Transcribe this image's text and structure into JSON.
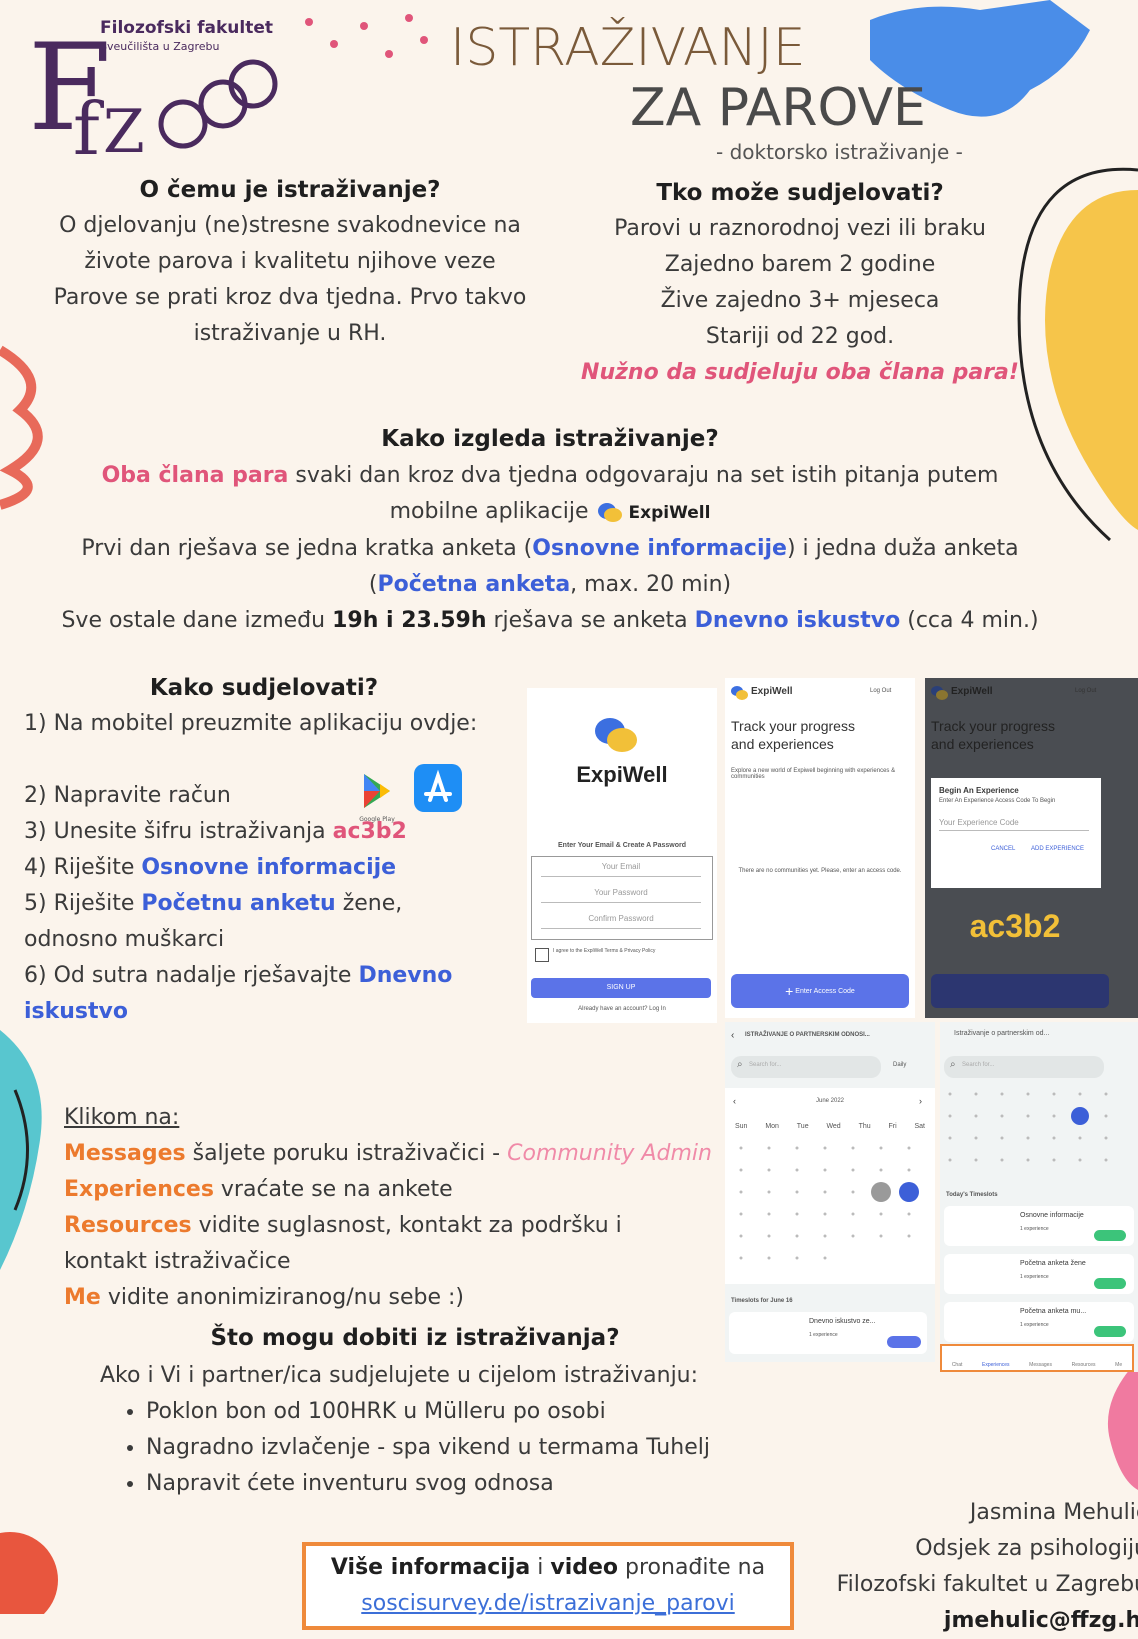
{
  "logo": {
    "faculty_name": "Filozofski fakultet",
    "faculty_sub": "Sveučilišta u Zagrebu",
    "monogram": "FfZG"
  },
  "title": {
    "line1": "ISTRAŽIVANJE",
    "line2": "ZA PAROVE",
    "subtitle": "- doktorsko istraživanje -"
  },
  "about": {
    "heading": "O čemu je istraživanje?",
    "line1": "O djelovanju (ne)stresne svakodnevice na",
    "line2": "živote parova i kvalitetu njihove veze",
    "line3": "Parove se prati kroz dva tjedna. Prvo takvo",
    "line4": "istraživanje u RH."
  },
  "who": {
    "heading": "Tko  može sudjelovati?",
    "line1": "Parovi u raznorodnoj vezi ili braku",
    "line2": "Zajedno barem 2 godine",
    "line3": "Žive zajedno 3+ mjeseca",
    "line4": "Stariji od 22 god.",
    "emphasis": "Nužno da sudjeluju oba člana para!"
  },
  "how": {
    "heading": "Kako izgleda istraživanje?",
    "p1_pink": "Oba člana para",
    "p1_rest": " svaki dan kroz dva tjedna odgovaraju na set istih pitanja putem",
    "p2": "mobilne aplikacije",
    "app_name": "ExpiWell",
    "p3_a": "Prvi dan rješava se jedna kratka anketa (",
    "p3_blue1": "Osnovne informacije",
    "p3_b": ") i jedna duža anketa",
    "p4_a": "(",
    "p4_blue": "Početna anketa",
    "p4_b": ", max. 20 min)",
    "p5_a": "Sve ostale dane između ",
    "p5_bold": "19h i 23.59h",
    "p5_b": " rješava se anketa ",
    "p5_blue": "Dnevno iskustvo",
    "p5_c": " (cca 4 min.)"
  },
  "steps": {
    "heading": "Kako sudjelovati?",
    "s1": "1) Na mobitel preuzmite aplikaciju ovdje:",
    "s2": "2) Napravite račun",
    "s3_a": "3) Unesite šifru istraživanja ",
    "s3_code": "ac3b2",
    "s4_a": "4) Riješite ",
    "s4_blue": "Osnovne informacije",
    "s5_a": "5) Riješite ",
    "s5_blue": "Početnu anketu",
    "s5_b": " žene,",
    "s5_c": "odnosno muškarci",
    "s6_a": "6) Od sutra nadalje rješavajte ",
    "s6_blue1": "Dnevno",
    "s6_blue2": "iskustvo",
    "google_play_label": "Google Play"
  },
  "click": {
    "heading": "Klikom na:",
    "messages": "Messages",
    "messages_rest": " šaljete poruku istraživačici - ",
    "community_admin": "Community Admin",
    "experiences": "Experiences",
    "experiences_rest": " vraćate se na ankete",
    "resources": "Resources",
    "resources_rest": " vidite suglasnost, kontakt za podršku i",
    "resources_rest2": "kontakt istraživačice",
    "me": "Me",
    "me_rest": " vidite anonimiziranog/nu sebe :)"
  },
  "gain": {
    "heading": "Što mogu dobiti iz istraživanja?",
    "intro": "Ako i Vi i partner/ica sudjelujete u cijelom istraživanju:",
    "items": [
      "Poklon bon od 100HRK u Mülleru po osobi",
      "Nagradno izvlačenje - spa vikend u termama Tuhelj",
      "Napravit ćete inventuru svog odnosa"
    ]
  },
  "more": {
    "bold1": "Više informacija",
    "mid": " i ",
    "bold2": "video",
    "rest": " pronađite na",
    "link": "soscisurvey.de/istrazivanje_parovi"
  },
  "contact": {
    "name": "Jasmina Mehulić",
    "dept": "Odsjek za psihologiju",
    "faculty": "Filozofski fakultet u Zagrebu",
    "email": "jmehulic@ffzg.hr"
  },
  "phones": {
    "p1": {
      "brand": "ExpiWell",
      "form_title": "Enter Your Email & Create A Password",
      "email": "Your Email",
      "password": "Your Password",
      "confirm": "Confirm Password",
      "agree": "I agree to the ExpiWell Terms & Privacy Policy",
      "signup": "SIGN UP",
      "login": "Already have an account? Log In"
    },
    "p2": {
      "brand": "ExpiWell",
      "logout": "Log Out",
      "track1": "Track your progress",
      "track2": "and experiences",
      "explore": "Explore a new world of Expiwell beginning with experiences & communities",
      "empty": "There are no communities yet. Please, enter an access code.",
      "enter_code": "Enter Access Code"
    },
    "p3": {
      "brand": "ExpiWell",
      "logout": "Log Out",
      "track1": "Track your progress",
      "track2": "and experiences",
      "dialog_title": "Begin An Experience",
      "dialog_sub": "Enter An Experience Access Code To Begin",
      "dialog_field": "Your Experience Code",
      "cancel": "CANCEL",
      "add": "ADD EXPERIENCE",
      "code": "ac3b2"
    },
    "p4": {
      "header": "ISTRAŽIVANJE O PARTNERSKIM ODNOSI...",
      "search": "Search for...",
      "view": "Daily",
      "month": "June 2022",
      "days": [
        "Sun",
        "Mon",
        "Tue",
        "Wed",
        "Thu",
        "Fri",
        "Sat"
      ],
      "timeslots": "Timeslots for June 16",
      "task": "Dnevno iskustvo ze...",
      "task_meta": "1 experience"
    },
    "p5": {
      "header": "Istraživanje o partnerskim od...",
      "search": "Search for...",
      "today": "Today's Timeslots",
      "tasks": [
        "Osnovne informacije",
        "Početna anketa žene",
        "Početna anketa mu..."
      ],
      "task_meta": "1 experience",
      "nav": [
        "Chat",
        "Experiences",
        "Messages",
        "Resources",
        "Me"
      ]
    }
  },
  "colors": {
    "pink": "#e0557a",
    "blue": "#3c5fd8",
    "orange": "#ec7a2d",
    "logo_purple": "#4a2a5e"
  }
}
